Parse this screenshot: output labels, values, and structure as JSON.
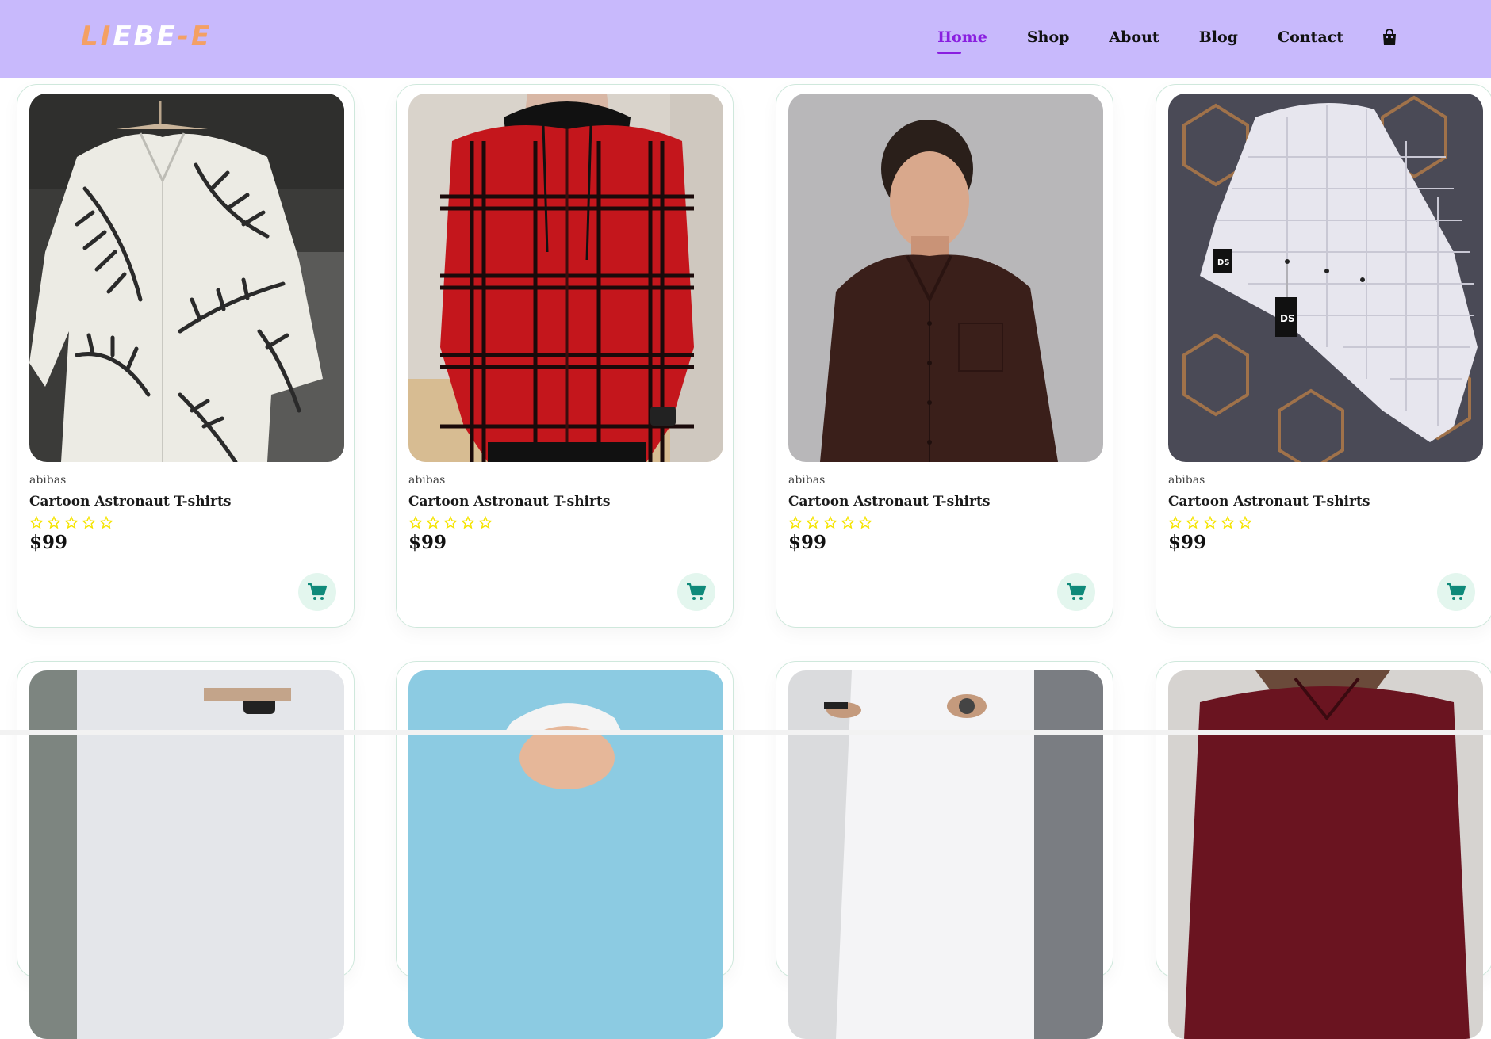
{
  "header": {
    "logo": {
      "part1": "LI",
      "part2": "EBE",
      "part3": "-E"
    },
    "nav": [
      {
        "label": "Home",
        "active": true
      },
      {
        "label": "Shop"
      },
      {
        "label": "About"
      },
      {
        "label": "Blog"
      },
      {
        "label": "Contact"
      }
    ],
    "cart_icon": "shopping-bag-icon",
    "colors": {
      "background": "#c8b9fc",
      "active": "#8a1fe0",
      "logo": "#f4a064"
    }
  },
  "products": [
    {
      "brand": "abibas",
      "title": "Cartoon Astronaut T-shirts",
      "rating": 0,
      "max_rating": 5,
      "price": "$99",
      "image": "palm-leaf-print-shirt"
    },
    {
      "brand": "abibas",
      "title": "Cartoon Astronaut T-shirts",
      "rating": 0,
      "max_rating": 5,
      "price": "$99",
      "image": "red-plaid-hooded-shirt"
    },
    {
      "brand": "abibas",
      "title": "Cartoon Astronaut T-shirts",
      "rating": 0,
      "max_rating": 5,
      "price": "$99",
      "image": "brown-checked-shirt-model"
    },
    {
      "brand": "abibas",
      "title": "Cartoon Astronaut T-shirts",
      "rating": 0,
      "max_rating": 5,
      "price": "$99",
      "image": "white-waffle-shirt"
    }
  ],
  "products_row2": [
    {
      "image": "grey-shirt-watch"
    },
    {
      "image": "white-cap-model"
    },
    {
      "image": "white-tee-tattoo"
    },
    {
      "image": "maroon-shirt-beard"
    }
  ],
  "cart_button_icon": "cart-icon",
  "star_color": "#f5e400",
  "cart_color": "#0f8a7a"
}
